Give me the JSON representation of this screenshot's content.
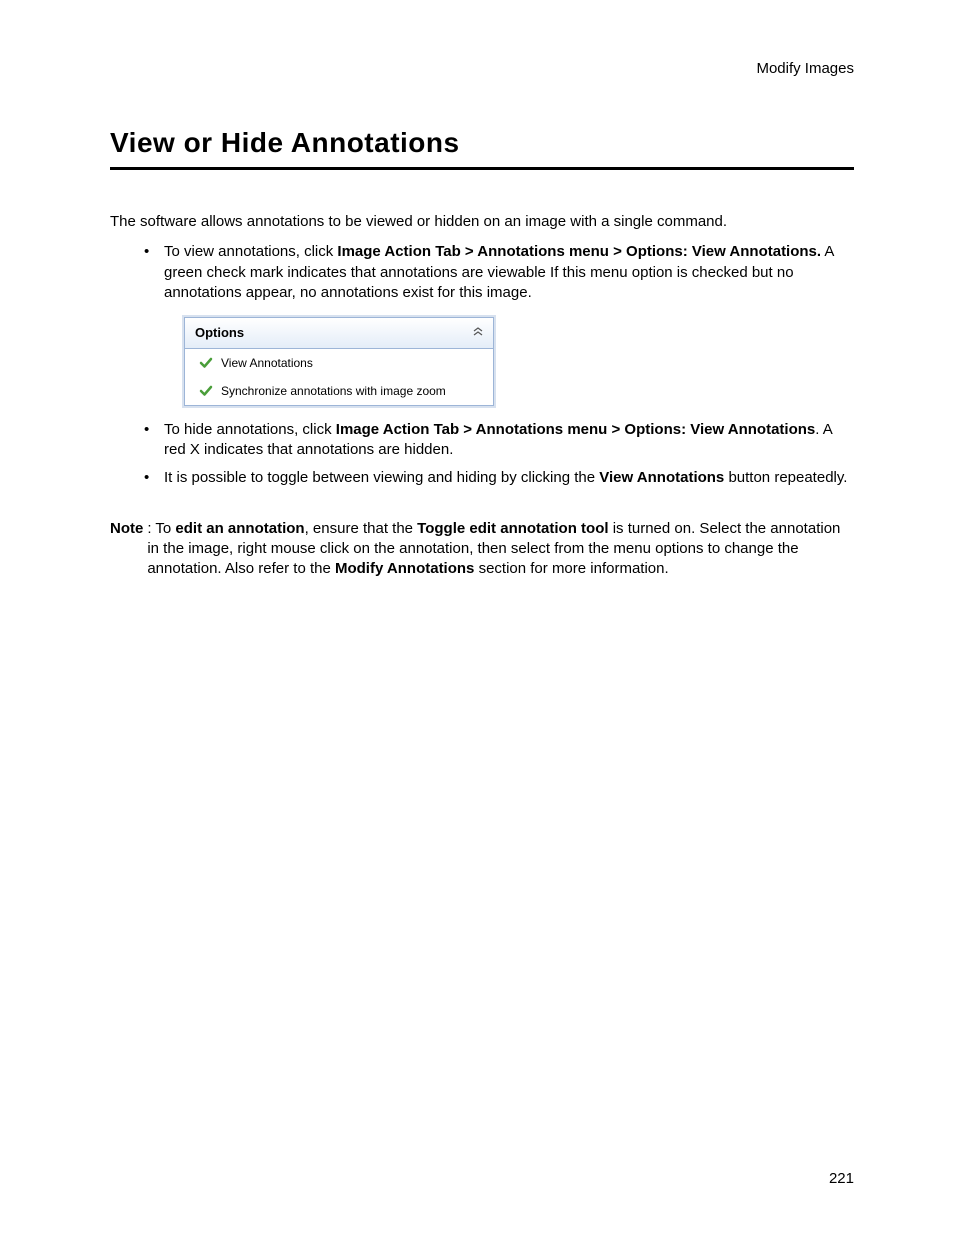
{
  "header": {
    "section": "Modify Images"
  },
  "title": "View or Hide Annotations",
  "intro": "The software allows annotations to be viewed or hidden on an image with a single command.",
  "bullets": [
    {
      "pre": "To view annotations, click ",
      "bold": "Image Action Tab > Annotations menu > Options: View Annotations.",
      "post": "  A green check mark indicates that annotations are viewable  If this menu option is checked but no annotations appear, no annotations exist for this image."
    },
    {
      "pre": "To hide annotations, click ",
      "bold": "Image Action Tab > Annotations menu > Options: View Annotations",
      "post": ".  A red X indicates that annotations are hidden."
    },
    {
      "pre": "It is possible to toggle between viewing and hiding by clicking the ",
      "bold": "View Annotations",
      "post": " button repeatedly."
    }
  ],
  "options_panel": {
    "title": "Options",
    "items": [
      "View Annotations",
      "Synchronize annotations with image zoom"
    ]
  },
  "note": {
    "label": "Note",
    "s1": ": To ",
    "b1": "edit an annotation",
    "s2": ", ensure that the ",
    "b2": "Toggle edit annotation tool",
    "s3": " is turned on.  Select the annotation in the image, right mouse click on the annotation, then select from the menu options to change the annotation. Also refer to the ",
    "b3": "Modify Annotations",
    "s4": " section for more information."
  },
  "page_number": "221"
}
